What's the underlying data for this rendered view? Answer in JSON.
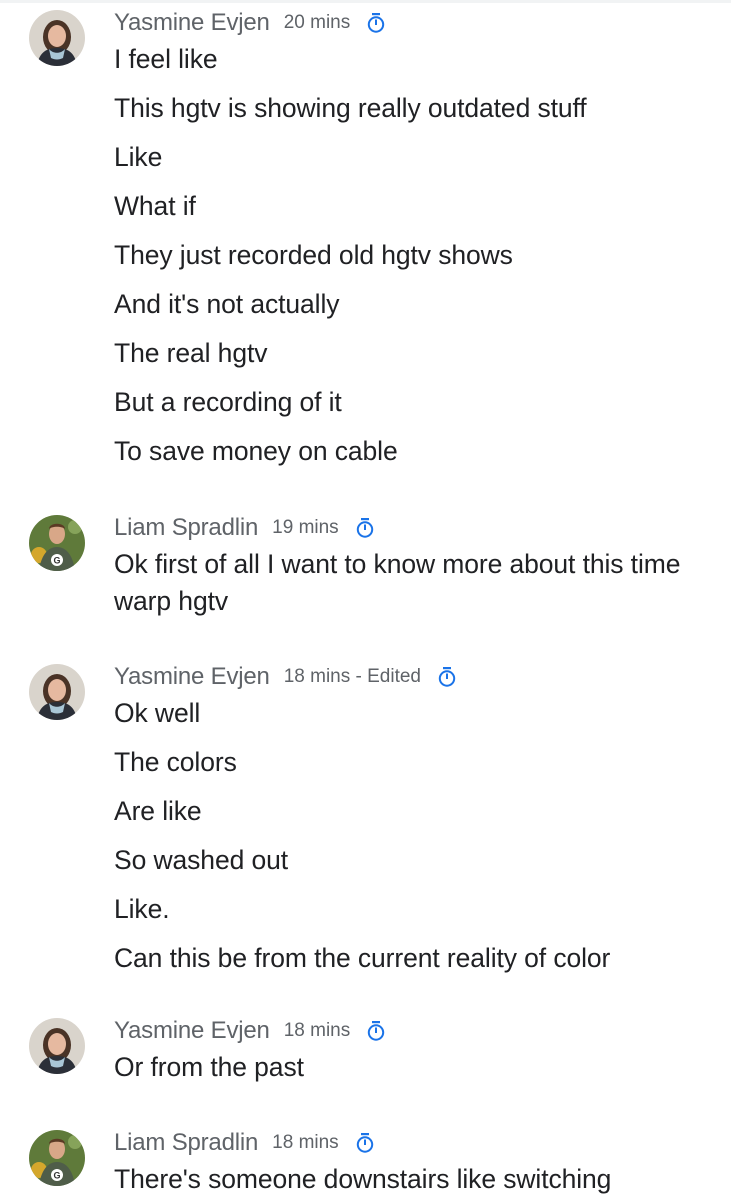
{
  "colors": {
    "name": "#5f6368",
    "text": "#202124",
    "timer_icon": "#1a73e8"
  },
  "groups": [
    {
      "author": "Yasmine Evjen",
      "avatar": "avatar-yasmine",
      "time": "20 mins",
      "icon": "timer-icon",
      "messages": [
        "I feel like",
        "This hgtv is showing really outdated stuff",
        "Like",
        "What if",
        "They just recorded old hgtv shows",
        "And it's not actually",
        "The real hgtv",
        "But a recording of it",
        "To save money on cable"
      ]
    },
    {
      "author": "Liam Spradlin",
      "avatar": "avatar-liam",
      "time": "19 mins",
      "icon": "timer-icon",
      "messages": [
        "Ok first of all I want to know more about this time warp hgtv"
      ]
    },
    {
      "author": "Yasmine Evjen",
      "avatar": "avatar-yasmine",
      "time": "18 mins - Edited",
      "icon": "timer-icon",
      "messages": [
        "Ok well",
        "The colors",
        "Are like",
        "So washed out",
        "Like.",
        "Can this be from the current reality of color"
      ]
    },
    {
      "author": "Yasmine Evjen",
      "avatar": "avatar-yasmine",
      "time": "18 mins",
      "icon": "timer-icon",
      "messages": [
        "Or from the past"
      ]
    },
    {
      "author": "Liam Spradlin",
      "avatar": "avatar-liam",
      "time": "18 mins",
      "icon": "timer-icon",
      "messages": [
        "There's someone downstairs like switching"
      ]
    }
  ]
}
